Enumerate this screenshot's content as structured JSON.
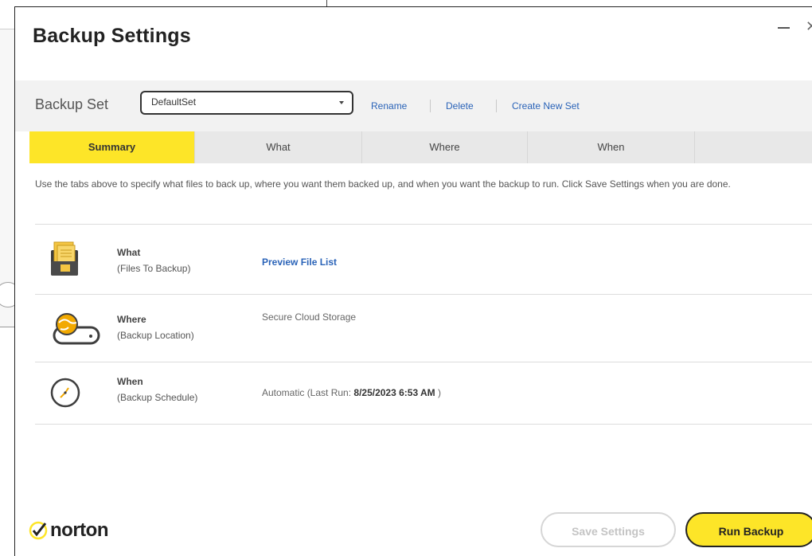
{
  "window": {
    "title": "Backup Settings"
  },
  "backup_set": {
    "label": "Backup Set",
    "selected": "DefaultSet",
    "actions": {
      "rename": "Rename",
      "delete": "Delete",
      "create": "Create New Set"
    }
  },
  "tabs": [
    {
      "label": "Summary",
      "active": true
    },
    {
      "label": "What",
      "active": false
    },
    {
      "label": "Where",
      "active": false
    },
    {
      "label": "When",
      "active": false
    }
  ],
  "description": "Use the tabs above to specify what files to back up, where you want them backed up, and when you want the backup to run. Click Save Settings when you are done.",
  "summary": {
    "what": {
      "title": "What",
      "subtitle": "(Files To Backup)",
      "value": "Preview File List",
      "icon": "files-folder-icon"
    },
    "where": {
      "title": "Where",
      "subtitle": "(Backup Location)",
      "value": "Secure Cloud Storage",
      "icon": "cloud-drive-icon"
    },
    "when": {
      "title": "When",
      "subtitle": "(Backup Schedule)",
      "value_prefix": "Automatic (Last Run: ",
      "value_date": "8/25/2023 6:53 AM",
      "value_suffix": " )",
      "icon": "clock-icon"
    }
  },
  "brand": {
    "name": "norton",
    "accent_color": "#fde528"
  },
  "buttons": {
    "save": "Save Settings",
    "run": "Run Backup"
  }
}
